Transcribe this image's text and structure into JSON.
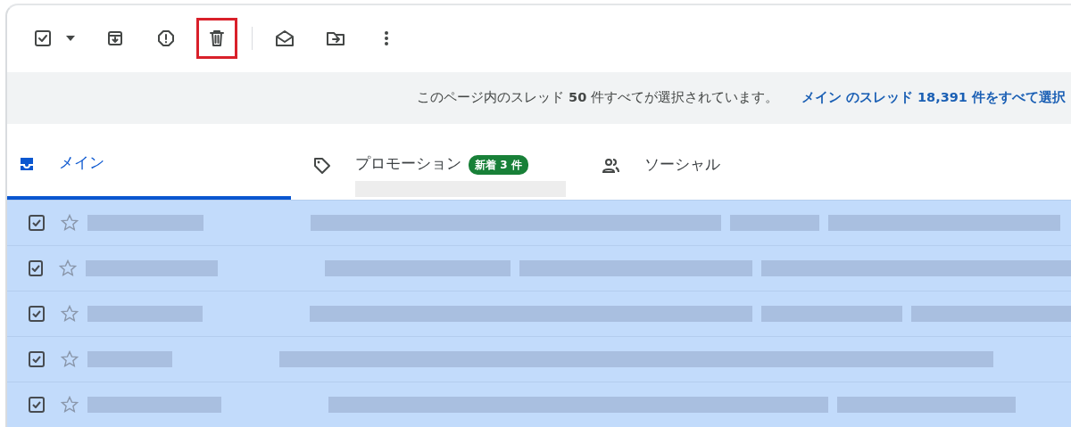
{
  "toolbar": {
    "items": [
      {
        "kind": "select",
        "checked": true
      },
      {
        "kind": "archive",
        "highlighted": false
      },
      {
        "kind": "spam",
        "highlighted": false
      },
      {
        "kind": "trash",
        "highlighted": true
      },
      {
        "kind": "separator"
      },
      {
        "kind": "read",
        "highlighted": false
      },
      {
        "kind": "move",
        "highlighted": false
      },
      {
        "kind": "more",
        "highlighted": false
      }
    ]
  },
  "banner": {
    "message": "このページ内のスレッド **50** 件すべてが選択されています。",
    "link": "メイン のスレッド 18,391 件をすべて選択"
  },
  "tabs": [
    {
      "kind": "inbox",
      "label": "メイン",
      "selected": true
    },
    {
      "kind": "tag",
      "label": "プロモーション",
      "badge": "新着 3 件",
      "selected": false
    },
    {
      "kind": "people",
      "label": "ソーシャル",
      "selected": false
    }
  ],
  "rows": [
    {
      "checked": true,
      "starred": false
    },
    {
      "checked": true,
      "starred": false
    },
    {
      "checked": true,
      "starred": false
    },
    {
      "checked": true,
      "starred": false
    },
    {
      "checked": true,
      "starred": false
    }
  ]
}
